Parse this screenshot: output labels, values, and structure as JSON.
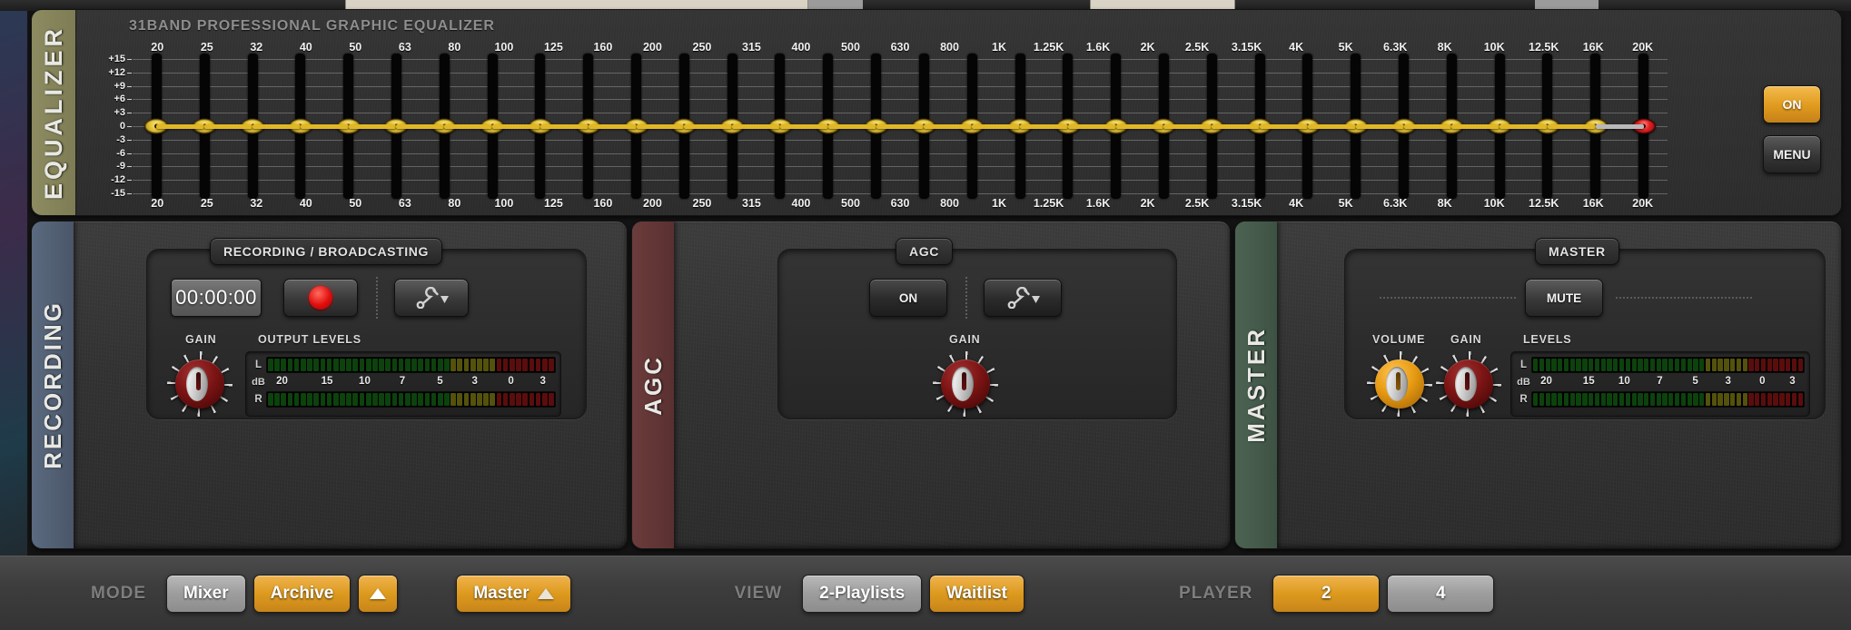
{
  "equalizer": {
    "side_tab": "EQUALIZER",
    "title": "31BAND PROFESSIONAL GRAPHIC EQUALIZER",
    "on_label": "ON",
    "menu_label": "MENU",
    "db_scale": [
      "+15",
      "+12",
      "+9",
      "+6",
      "+3",
      "0",
      "-3",
      "-6",
      "-9",
      "-12",
      "-15"
    ],
    "frequencies": [
      "20",
      "25",
      "32",
      "40",
      "50",
      "63",
      "80",
      "100",
      "125",
      "160",
      "200",
      "250",
      "315",
      "400",
      "500",
      "630",
      "800",
      "1K",
      "1.25K",
      "1.6K",
      "2K",
      "2.5K",
      "3.15K",
      "4K",
      "5K",
      "6.3K",
      "8K",
      "10K",
      "12.5K",
      "16K",
      "20K"
    ],
    "band_values_db": [
      0,
      0,
      0,
      0,
      0,
      0,
      0,
      0,
      0,
      0,
      0,
      0,
      0,
      0,
      0,
      0,
      0,
      0,
      0,
      0,
      0,
      0,
      0,
      0,
      0,
      0,
      0,
      0,
      0,
      0,
      0
    ],
    "preamp_value_db": 0,
    "knob_color": "#e8c63c",
    "preamp_knob_color": "#e02020",
    "curve_color": "#e0b725"
  },
  "recording": {
    "side_tab": "RECORDING",
    "header": "RECORDING / BROADCASTING",
    "timer": "00:00:00",
    "record_button": "record-dot",
    "settings_button": "wrench-dropdown",
    "gain_label": "GAIN",
    "output_levels_label": "OUTPUT LEVELS",
    "meter": {
      "left_label": "L",
      "right_label": "R",
      "unit_label": "dB",
      "scale": [
        "20",
        "15",
        "10",
        "7",
        "5",
        "3",
        "0",
        "3"
      ]
    },
    "tab_color": "#5b6a80"
  },
  "agc": {
    "side_tab": "AGC",
    "header": "AGC",
    "on_label": "ON",
    "on_active": false,
    "settings_button": "wrench-dropdown",
    "gain_label": "GAIN",
    "tab_color": "#6b3c3c"
  },
  "master": {
    "side_tab": "MASTER",
    "header": "MASTER",
    "mute_label": "MUTE",
    "volume_label": "VOLUME",
    "gain_label": "GAIN",
    "levels_label": "LEVELS",
    "meter": {
      "left_label": "L",
      "right_label": "R",
      "unit_label": "dB",
      "scale": [
        "20",
        "15",
        "10",
        "7",
        "5",
        "3",
        "0",
        "3"
      ]
    },
    "tab_color": "#4c6352",
    "volume_knob_color": "#e79a12"
  },
  "toolbar": {
    "mode_label": "MODE",
    "mode_mixer": "Mixer",
    "mode_archive": "Archive",
    "master_button": "Master",
    "view_label": "VIEW",
    "view_playlists": "2-Playlists",
    "view_waitlist": "Waitlist",
    "player_label": "PLAYER",
    "player_2": "2",
    "player_4": "4"
  }
}
